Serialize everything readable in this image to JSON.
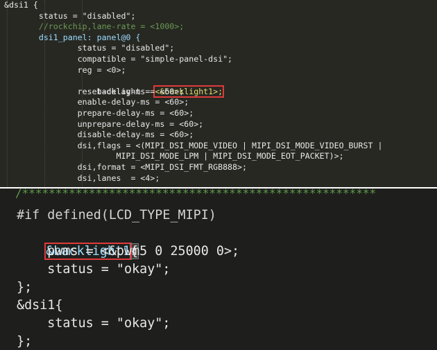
{
  "top_code": {
    "lines": [
      "&dsi1 {",
      "        status = \"disabled\";",
      "        //rockchip,lane-rate = <1000>;",
      "        dsi1_panel: panel@0 {",
      "                status = \"disabled\";",
      "                compatible = \"simple-panel-dsi\";",
      "                reg = <0>;",
      "                backlight = ",
      "<&backlight1>;",
      "                reset-delay-ms = <60>;",
      "                enable-delay-ms = <60>;",
      "                prepare-delay-ms = <60>;",
      "                unprepare-delay-ms = <60>;",
      "                disable-delay-ms = <60>;",
      "                dsi,flags = <(MIPI_DSI_MODE_VIDEO | MIPI_DSI_MODE_VIDEO_BURST |",
      "                        MIPI_DSI_MODE_LPM | MIPI_DSI_MODE_EOT_PACKET)>;",
      "                dsi,format = <MIPI_DSI_FMT_RGB888>;",
      "                dsi,lanes  = <4>;"
    ]
  },
  "bottom_code": {
    "comment_bar": "/*****************************************************",
    "lines": [
      "#if defined(LCD_TYPE_MIPI)",
      "&backlight1",
      "{",
      "    pwms = <&pwm5 0 25000 0>;",
      "    status = \"okay\";",
      "};",
      "&dsi1{",
      "    status = \"okay\";",
      "};"
    ]
  },
  "colors": {
    "editor_bg": "#272822",
    "editor_bg_2": "#1e1f1c",
    "highlight_box": "#e03a3a",
    "string": "#e6db74",
    "comment": "#6b9955",
    "label": "#9cdcfe"
  }
}
